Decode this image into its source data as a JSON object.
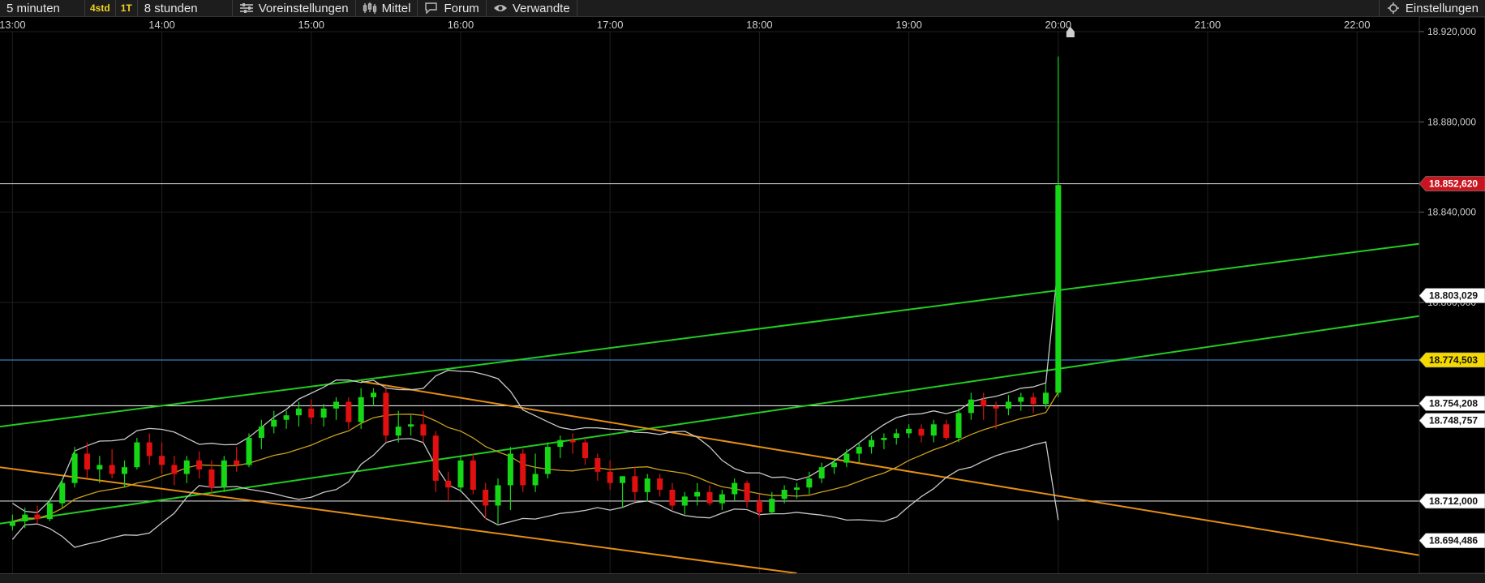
{
  "toolbar": {
    "interval": "5 minuten",
    "quick_a": "4std",
    "quick_b": "1T",
    "range": "8 stunden",
    "presets": "Voreinstellungen",
    "indicators": "Mittel",
    "forum": "Forum",
    "related": "Verwandte",
    "settings": "Einstellungen"
  },
  "colors": {
    "bull": "#16d716",
    "bear": "#e01010",
    "trend_green": "#22cc22",
    "trend_orange": "#e38e14",
    "bands": "#c8c8c8",
    "ma": "#caa01e",
    "last_price_bg": "#c8141e",
    "cursor_bg": "#f5d800"
  },
  "chart_data": {
    "type": "candlestick",
    "x_ticks": [
      "13:00",
      "14:00",
      "15:00",
      "16:00",
      "17:00",
      "18:00",
      "19:00",
      "20:00",
      "21:00",
      "22:00"
    ],
    "y_ticks": [
      "18.920,000",
      "18.880,000",
      "18.840,000",
      "18.800,000"
    ],
    "price_labels": {
      "last": "18.852,620",
      "level_a": "18.803,029",
      "cursor": "18.774,503",
      "level_b": "18.754,208",
      "level_c": "18.748,757",
      "level_d": "18.712,000",
      "level_e": "18.694,486"
    },
    "ylim": [
      18680,
      18920
    ],
    "xlim": [
      "12:55",
      "22:25"
    ],
    "candles": [
      [
        "13:00",
        18701,
        18706,
        18699,
        18703
      ],
      [
        "13:05",
        18703,
        18709,
        18700,
        18706
      ],
      [
        "13:10",
        18706,
        18710,
        18702,
        18704
      ],
      [
        "13:15",
        18704,
        18713,
        18703,
        18711
      ],
      [
        "13:20",
        18711,
        18722,
        18709,
        18720
      ],
      [
        "13:25",
        18720,
        18736,
        18718,
        18733
      ],
      [
        "13:30",
        18733,
        18738,
        18722,
        18726
      ],
      [
        "13:35",
        18726,
        18732,
        18720,
        18728
      ],
      [
        "13:40",
        18728,
        18735,
        18722,
        18724
      ],
      [
        "13:45",
        18724,
        18730,
        18718,
        18727
      ],
      [
        "13:50",
        18727,
        18740,
        18726,
        18738
      ],
      [
        "13:55",
        18738,
        18742,
        18728,
        18732
      ],
      [
        "14:00",
        18732,
        18738,
        18724,
        18728
      ],
      [
        "14:05",
        18728,
        18732,
        18719,
        18724
      ],
      [
        "14:10",
        18724,
        18732,
        18720,
        18730
      ],
      [
        "14:15",
        18730,
        18734,
        18722,
        18726
      ],
      [
        "14:20",
        18726,
        18730,
        18715,
        18718
      ],
      [
        "14:25",
        18718,
        18732,
        18716,
        18730
      ],
      [
        "14:30",
        18730,
        18736,
        18725,
        18728
      ],
      [
        "14:35",
        18728,
        18742,
        18727,
        18740
      ],
      [
        "14:40",
        18740,
        18748,
        18735,
        18745
      ],
      [
        "14:45",
        18745,
        18752,
        18742,
        18748
      ],
      [
        "14:50",
        18748,
        18752,
        18744,
        18750
      ],
      [
        "14:55",
        18750,
        18756,
        18745,
        18753
      ],
      [
        "15:00",
        18753,
        18757,
        18746,
        18749
      ],
      [
        "15:05",
        18749,
        18755,
        18745,
        18753
      ],
      [
        "15:10",
        18753,
        18758,
        18748,
        18756
      ],
      [
        "15:15",
        18756,
        18758,
        18744,
        18747
      ],
      [
        "15:20",
        18747,
        18762,
        18744,
        18758
      ],
      [
        "15:25",
        18758,
        18762,
        18754,
        18760
      ],
      [
        "15:30",
        18760,
        18762,
        18738,
        18741
      ],
      [
        "15:35",
        18741,
        18752,
        18738,
        18745
      ],
      [
        "15:40",
        18745,
        18750,
        18741,
        18746
      ],
      [
        "15:45",
        18746,
        18752,
        18738,
        18741
      ],
      [
        "15:50",
        18741,
        18743,
        18716,
        18721
      ],
      [
        "15:55",
        18721,
        18725,
        18712,
        18718
      ],
      [
        "16:00",
        18718,
        18732,
        18716,
        18730
      ],
      [
        "16:05",
        18730,
        18733,
        18715,
        18717
      ],
      [
        "16:10",
        18717,
        18720,
        18704,
        18710
      ],
      [
        "16:15",
        18710,
        18722,
        18702,
        18719
      ],
      [
        "16:20",
        18719,
        18736,
        18708,
        18733
      ],
      [
        "16:25",
        18733,
        18735,
        18716,
        18719
      ],
      [
        "16:30",
        18719,
        18733,
        18716,
        18724
      ],
      [
        "16:35",
        18724,
        18738,
        18722,
        18736
      ],
      [
        "16:40",
        18736,
        18741,
        18731,
        18739
      ],
      [
        "16:45",
        18739,
        18742,
        18733,
        18738
      ],
      [
        "16:50",
        18738,
        18740,
        18728,
        18731
      ],
      [
        "16:55",
        18731,
        18733,
        18721,
        18725
      ],
      [
        "17:00",
        18725,
        18730,
        18717,
        18720
      ],
      [
        "17:05",
        18720,
        18723,
        18709,
        18723
      ],
      [
        "17:10",
        18723,
        18727,
        18712,
        18716
      ],
      [
        "17:15",
        18716,
        18724,
        18712,
        18722
      ],
      [
        "17:20",
        18722,
        18724,
        18714,
        18717
      ],
      [
        "17:25",
        18717,
        18720,
        18708,
        18710
      ],
      [
        "17:30",
        18710,
        18716,
        18706,
        18714
      ],
      [
        "17:35",
        18714,
        18720,
        18710,
        18716
      ],
      [
        "17:40",
        18716,
        18719,
        18710,
        18711
      ],
      [
        "17:45",
        18711,
        18717,
        18708,
        18715
      ],
      [
        "17:50",
        18715,
        18722,
        18712,
        18720
      ],
      [
        "17:55",
        18720,
        18721,
        18709,
        18712
      ],
      [
        "18:00",
        18712,
        18715,
        18705,
        18707
      ],
      [
        "18:05",
        18707,
        18716,
        18706,
        18713
      ],
      [
        "18:10",
        18713,
        18719,
        18711,
        18717
      ],
      [
        "18:15",
        18717,
        18720,
        18713,
        18718
      ],
      [
        "18:20",
        18718,
        18725,
        18715,
        18722
      ],
      [
        "18:25",
        18722,
        18729,
        18720,
        18727
      ],
      [
        "18:30",
        18727,
        18731,
        18724,
        18729
      ],
      [
        "18:35",
        18729,
        18735,
        18727,
        18733
      ],
      [
        "18:40",
        18733,
        18738,
        18729,
        18736
      ],
      [
        "18:45",
        18736,
        18741,
        18733,
        18739
      ],
      [
        "18:50",
        18739,
        18742,
        18735,
        18740
      ],
      [
        "18:55",
        18740,
        18744,
        18737,
        18742
      ],
      [
        "19:00",
        18742,
        18746,
        18740,
        18744
      ],
      [
        "19:05",
        18744,
        18746,
        18738,
        18741
      ],
      [
        "19:10",
        18741,
        18748,
        18738,
        18746
      ],
      [
        "19:15",
        18746,
        18748,
        18739,
        18740
      ],
      [
        "19:20",
        18740,
        18753,
        18738,
        18751
      ],
      [
        "19:25",
        18751,
        18760,
        18748,
        18757
      ],
      [
        "19:30",
        18757,
        18760,
        18748,
        18754
      ],
      [
        "19:35",
        18754,
        18756,
        18744,
        18753
      ],
      [
        "19:40",
        18753,
        18759,
        18750,
        18756
      ],
      [
        "19:45",
        18756,
        18760,
        18752,
        18758
      ],
      [
        "19:50",
        18758,
        18760,
        18751,
        18755
      ],
      [
        "19:55",
        18755,
        18764,
        18753,
        18760
      ],
      [
        "20:00",
        18760,
        18909,
        18758,
        18852
      ]
    ]
  }
}
